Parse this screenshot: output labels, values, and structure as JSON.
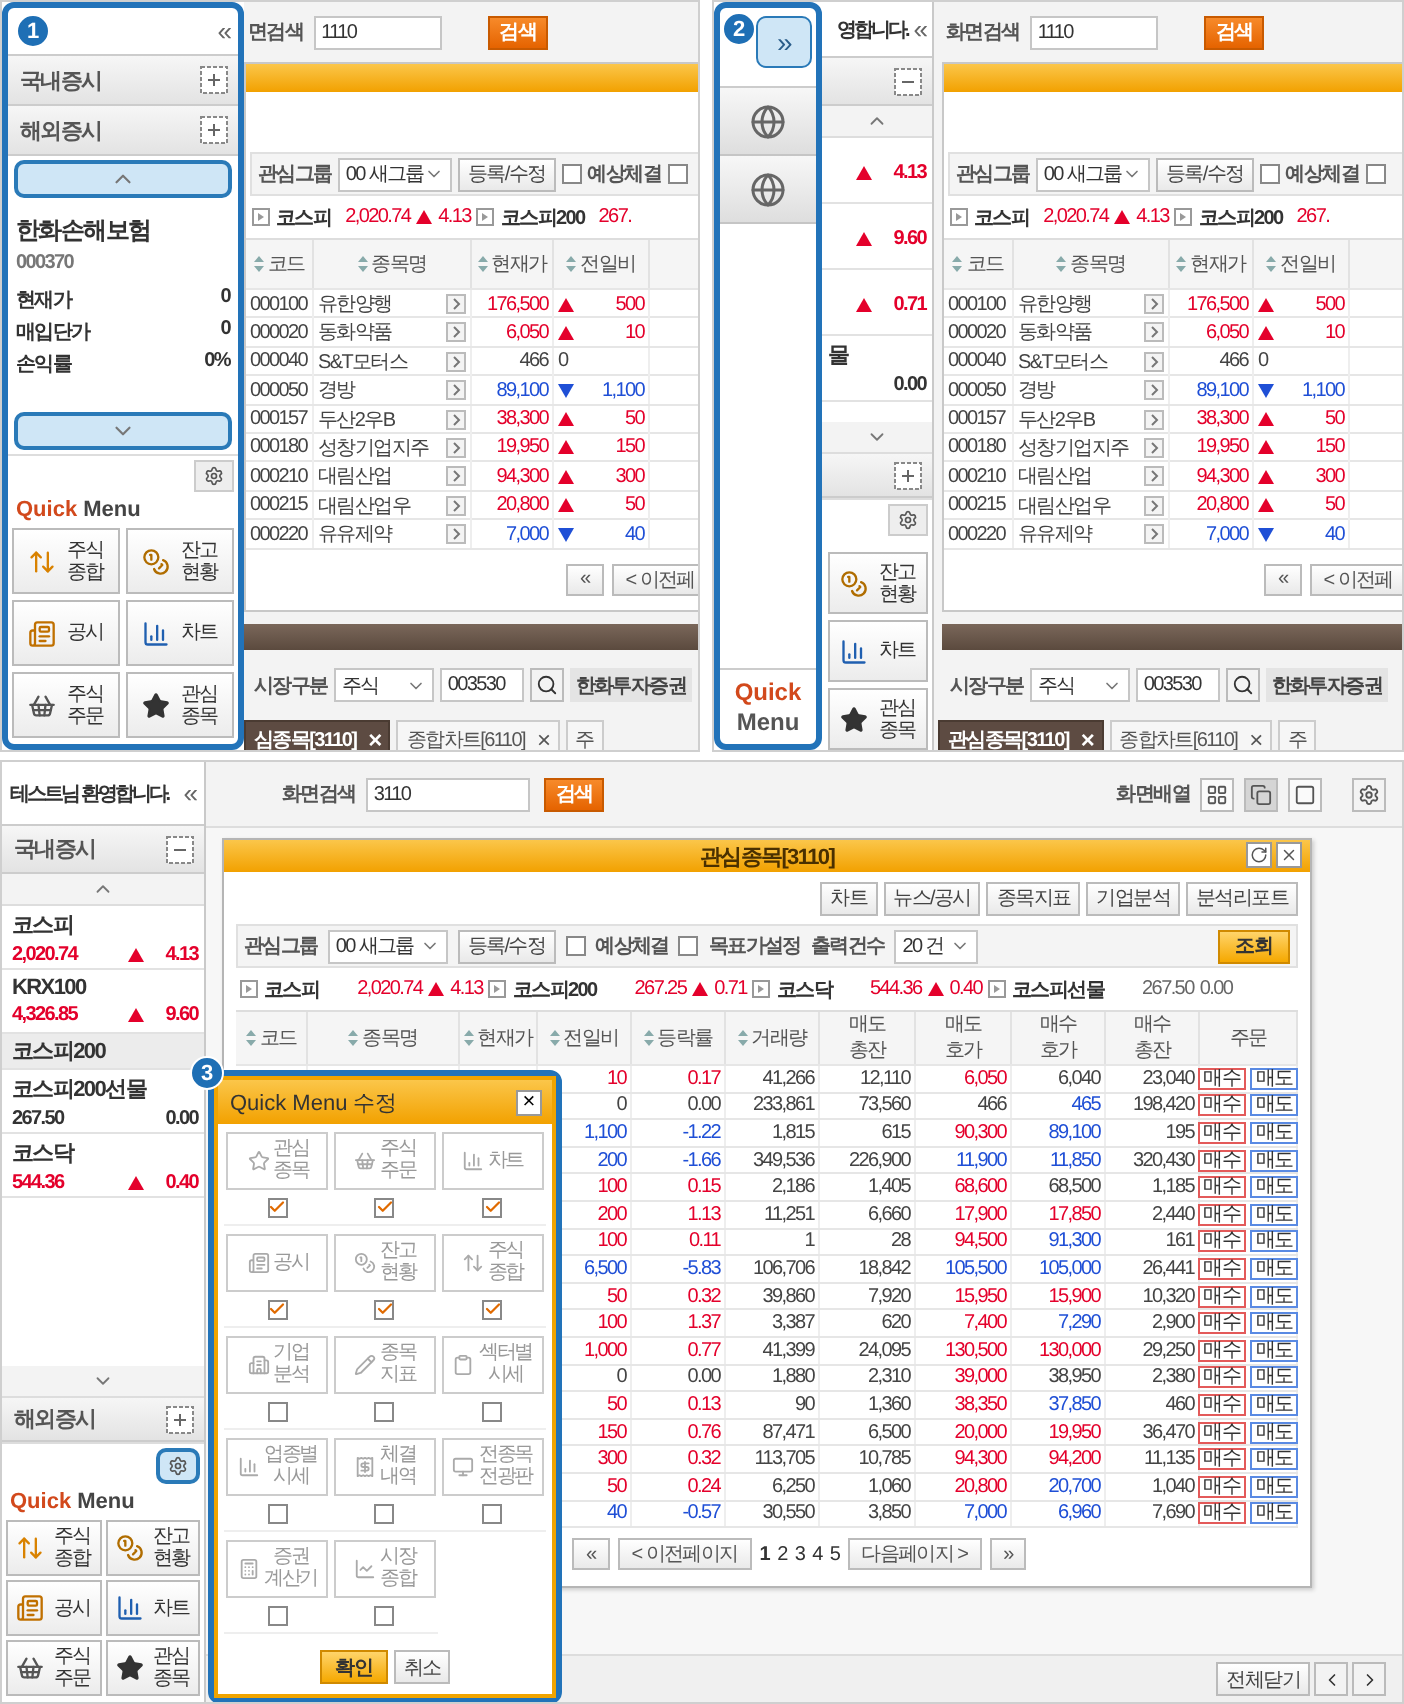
{
  "panel_1": {
    "badge": "1",
    "sidebar": {
      "collapse": "«",
      "sections": [
        {
          "label": "국내증시",
          "expanded": false
        },
        {
          "label": "해외증시",
          "expanded": false
        }
      ],
      "holding": {
        "name": "한화손해보험",
        "code": "000370",
        "fields": [
          {
            "label": "현재가",
            "value": "0"
          },
          {
            "label": "매입단가",
            "value": "0"
          },
          {
            "label": "손익률",
            "value": "0%"
          }
        ]
      },
      "settings_active": false,
      "quick_menu": {
        "accent": "Quick",
        "title": "Menu",
        "buttons": [
          {
            "kind": "updown",
            "lines": [
              "주식",
              "종합"
            ]
          },
          {
            "kind": "balance",
            "lines": [
              "잔고",
              "현황"
            ]
          },
          {
            "kind": "notice",
            "lines": [
              "공시"
            ]
          },
          {
            "kind": "chart",
            "lines": [
              "차트"
            ]
          },
          {
            "kind": "basket",
            "lines": [
              "주식",
              "주문"
            ]
          },
          {
            "kind": "star",
            "lines": [
              "관심",
              "종목"
            ]
          }
        ]
      }
    },
    "main": {
      "search": {
        "label": "면검색",
        "value": "1110",
        "button": "검색"
      },
      "group": {
        "label": "관심그룹",
        "value": "00 새그룹",
        "button": "등록/수정",
        "checks": [
          {
            "label": "예상체결",
            "checked": false
          },
          {
            "checked": false
          }
        ]
      },
      "indices": [
        {
          "name": "코스피",
          "value": "2,020.74",
          "change": "4.13",
          "rising": true,
          "falling": false
        },
        {
          "name": "코스피200",
          "value": "267.",
          "rising": true,
          "falling": false
        }
      ],
      "columns": [
        "코드",
        "종목명",
        "현재가",
        "전일비"
      ],
      "rows": [
        {
          "code": "000100",
          "name": "유한양행",
          "price": "176,500",
          "change": "500",
          "rising": true,
          "falling": false
        },
        {
          "code": "000020",
          "name": "동화약품",
          "price": "6,050",
          "change": "10",
          "rising": true,
          "falling": false
        },
        {
          "code": "000040",
          "name": "S&T모터스",
          "price": "466",
          "change": "0",
          "rising": false,
          "falling": false
        },
        {
          "code": "000050",
          "name": "경방",
          "price": "89,100",
          "change": "1,100",
          "rising": false,
          "falling": true
        },
        {
          "code": "000157",
          "name": "두산2우B",
          "price": "38,300",
          "change": "50",
          "rising": true,
          "falling": false
        },
        {
          "code": "000180",
          "name": "성창기업지주",
          "price": "19,950",
          "change": "150",
          "rising": true,
          "falling": false
        },
        {
          "code": "000210",
          "name": "대림산업",
          "price": "94,300",
          "change": "300",
          "rising": true,
          "falling": false
        },
        {
          "code": "000215",
          "name": "대림산업우",
          "price": "20,800",
          "change": "50",
          "rising": true,
          "falling": false
        },
        {
          "code": "000220",
          "name": "유유제약",
          "price": "7,000",
          "change": "40",
          "rising": false,
          "falling": true
        }
      ],
      "pager": [
        "«",
        "< 이전페"
      ],
      "market": {
        "label": "시장구분",
        "value": "주식",
        "code": "003530",
        "name": "한화투자증권"
      },
      "tabs": [
        {
          "label": "심종목[3110]",
          "close": "×",
          "selected": true
        },
        {
          "label": "종합차트[6110]",
          "close": "×",
          "selected": false
        },
        {
          "label": "주",
          "selected": false
        }
      ]
    }
  },
  "panel_2": {
    "badge": "2",
    "expand": "»",
    "strip_quick": {
      "accent": "Quick",
      "title": "Menu"
    },
    "behind": {
      "welcome": "영합니다.",
      "collapse": "«",
      "sections": [
        {
          "expanded": true
        },
        {
          "expanded": false
        }
      ],
      "quotes": [
        {
          "change": "4.13",
          "rising": true,
          "falling": false
        },
        {
          "change": "9.60",
          "rising": true,
          "falling": false
        },
        {
          "change": "0.71",
          "rising": true,
          "falling": false
        },
        {
          "name": "물",
          "change": "0.00",
          "rising": false,
          "falling": false
        }
      ],
      "buttons": [
        {
          "kind": "balance",
          "lines": [
            "잔고",
            "현황"
          ]
        },
        {
          "kind": "chart",
          "lines": [
            "차트"
          ]
        },
        {
          "kind": "star",
          "lines": [
            "관심",
            "종목"
          ]
        }
      ]
    },
    "main": {
      "search": {
        "label": "화면검색",
        "value": "1110",
        "button": "검색"
      },
      "group": {
        "label": "관심그룹",
        "value": "00 새그룹",
        "button": "등록/수정",
        "checks": [
          {
            "label": "예상체결",
            "checked": false
          },
          {
            "checked": false
          }
        ]
      },
      "indices": [
        {
          "name": "코스피",
          "value": "2,020.74",
          "change": "4.13",
          "rising": true,
          "falling": false
        },
        {
          "name": "코스피200",
          "value": "267.",
          "rising": true,
          "falling": false
        }
      ],
      "columns": [
        "코드",
        "종목명",
        "현재가",
        "전일비"
      ],
      "rows": [
        {
          "code": "000100",
          "name": "유한양행",
          "price": "176,500",
          "change": "500",
          "rising": true,
          "falling": false
        },
        {
          "code": "000020",
          "name": "동화약품",
          "price": "6,050",
          "change": "10",
          "rising": true,
          "falling": false
        },
        {
          "code": "000040",
          "name": "S&T모터스",
          "price": "466",
          "change": "0",
          "rising": false,
          "falling": false
        },
        {
          "code": "000050",
          "name": "경방",
          "price": "89,100",
          "change": "1,100",
          "rising": false,
          "falling": true
        },
        {
          "code": "000157",
          "name": "두산2우B",
          "price": "38,300",
          "change": "50",
          "rising": true,
          "falling": false
        },
        {
          "code": "000180",
          "name": "성창기업지주",
          "price": "19,950",
          "change": "150",
          "rising": true,
          "falling": false
        },
        {
          "code": "000210",
          "name": "대림산업",
          "price": "94,300",
          "change": "300",
          "rising": true,
          "falling": false
        },
        {
          "code": "000215",
          "name": "대림산업우",
          "price": "20,800",
          "change": "50",
          "rising": true,
          "falling": false
        },
        {
          "code": "000220",
          "name": "유유제약",
          "price": "7,000",
          "change": "40",
          "rising": false,
          "falling": true
        }
      ],
      "pager": [
        "«",
        "< 이전페"
      ],
      "market": {
        "label": "시장구분",
        "value": "주식",
        "code": "003530",
        "name": "한화투자증권"
      },
      "tabs": [
        {
          "label": "관심종목[3110]",
          "close": "×",
          "selected": true
        },
        {
          "label": "종합차트[6110]",
          "close": "×",
          "selected": false
        },
        {
          "label": "주",
          "selected": false
        }
      ]
    }
  },
  "panel_3": {
    "badge": "3",
    "sidebar": {
      "welcome": "테스트님 환영합니다.",
      "collapse": "«",
      "sections": [
        {
          "label": "국내증시",
          "expanded": true
        },
        {
          "label": "해외증시",
          "expanded": false
        }
      ],
      "quotes": [
        {
          "name": "코스피",
          "value": "2,020.74",
          "change": "4.13",
          "rising": true,
          "falling": false,
          "selected": false
        },
        {
          "name": "KRX100",
          "value": "4,326.85",
          "change": "9.60",
          "rising": true,
          "falling": false,
          "selected": false
        },
        {
          "name": "코스피200",
          "selected": true
        },
        {
          "name": "코스피200선물",
          "value": "267.50",
          "change": "0.00",
          "rising": false,
          "falling": false,
          "selected": false
        },
        {
          "name": "코스닥",
          "value": "544.36",
          "change": "0.40",
          "rising": true,
          "falling": false,
          "selected": false
        }
      ],
      "settings_active": true,
      "quick_menu": {
        "accent": "Quick",
        "title": "Menu",
        "buttons": [
          {
            "kind": "updown",
            "lines": [
              "주식",
              "종합"
            ]
          },
          {
            "kind": "balance",
            "lines": [
              "잔고",
              "현황"
            ]
          },
          {
            "kind": "notice",
            "lines": [
              "공시"
            ]
          },
          {
            "kind": "chart",
            "lines": [
              "차트"
            ]
          },
          {
            "kind": "basket",
            "lines": [
              "주식",
              "주문"
            ]
          },
          {
            "kind": "star",
            "lines": [
              "관심",
              "종목"
            ]
          }
        ]
      }
    },
    "topbar": {
      "search": {
        "label": "화면검색",
        "value": "3110",
        "button": "검색"
      },
      "layout_label": "화면배열",
      "layouts": [
        {
          "selected": false
        },
        {
          "selected": true
        },
        {
          "selected": false
        }
      ]
    },
    "window": {
      "title": "관심종목[3110]",
      "tools": [
        "차트",
        "뉴스/공시",
        "종목지표",
        "기업분석",
        "분석리포트"
      ],
      "group": {
        "label": "관심그룹",
        "value": "00 새그룹",
        "button": "등록/수정",
        "checks": [
          {
            "label": "예상체결",
            "checked": false
          },
          {
            "label": "목표가설정",
            "checked": false
          }
        ],
        "count_label": "출력건수",
        "count_value": "20 건",
        "query": "조회"
      },
      "indices": [
        {
          "name": "코스피",
          "value": "2,020.74",
          "change": "4.13",
          "rising": true,
          "falling": false
        },
        {
          "name": "코스피200",
          "value": "267.25",
          "change": "0.71",
          "rising": true,
          "falling": false
        },
        {
          "name": "코스닥",
          "value": "544.36",
          "change": "0.40",
          "rising": true,
          "falling": false
        },
        {
          "name": "코스피선물",
          "value": "267.50",
          "change": "0.00",
          "rising": false,
          "falling": false
        }
      ],
      "columns": [
        {
          "lines": [
            "코드"
          ],
          "sortable": true
        },
        {
          "lines": [
            "종목명"
          ],
          "sortable": true
        },
        {
          "lines": [
            "현재가"
          ],
          "sortable": true
        },
        {
          "lines": [
            "전일비"
          ],
          "sortable": true
        },
        {
          "lines": [
            "등락률"
          ],
          "sortable": true
        },
        {
          "lines": [
            "거래량"
          ],
          "sortable": true
        },
        {
          "lines": [
            "매도",
            "총잔"
          ],
          "sortable": false
        },
        {
          "lines": [
            "매도",
            "호가"
          ],
          "sortable": false
        },
        {
          "lines": [
            "매수",
            "호가"
          ],
          "sortable": false
        },
        {
          "lines": [
            "매수",
            "총잔"
          ],
          "sortable": false
        },
        {
          "lines": [
            "주문"
          ],
          "sortable": false
        }
      ],
      "rows": [
        {
          "change": "10",
          "rate": "0.17",
          "rising": true,
          "falling": false,
          "volume": "41,266",
          "ask_total": "12,110",
          "ask": "6,050",
          "ask_rising": true,
          "ask_falling": false,
          "bid": "6,040",
          "bid_rising": false,
          "bid_falling": false,
          "bid_total": "23,040",
          "buy": "매수",
          "sell": "매도"
        },
        {
          "change": "0",
          "rate": "0.00",
          "rising": false,
          "falling": false,
          "volume": "233,861",
          "ask_total": "73,560",
          "ask": "466",
          "ask_rising": false,
          "ask_falling": false,
          "bid": "465",
          "bid_rising": false,
          "bid_falling": true,
          "bid_total": "198,420",
          "buy": "매수",
          "sell": "매도"
        },
        {
          "change": "1,100",
          "rate": "-1.22",
          "rising": false,
          "falling": true,
          "volume": "1,815",
          "ask_total": "615",
          "ask": "90,300",
          "ask_rising": true,
          "ask_falling": false,
          "bid": "89,100",
          "bid_rising": false,
          "bid_falling": true,
          "bid_total": "195",
          "buy": "매수",
          "sell": "매도"
        },
        {
          "change": "200",
          "rate": "-1.66",
          "rising": false,
          "falling": true,
          "volume": "349,536",
          "ask_total": "226,900",
          "ask": "11,900",
          "ask_rising": false,
          "ask_falling": true,
          "bid": "11,850",
          "bid_rising": false,
          "bid_falling": true,
          "bid_total": "320,430",
          "buy": "매수",
          "sell": "매도"
        },
        {
          "change": "100",
          "rate": "0.15",
          "rising": true,
          "falling": false,
          "volume": "2,186",
          "ask_total": "1,405",
          "ask": "68,600",
          "ask_rising": true,
          "ask_falling": false,
          "bid": "68,500",
          "bid_rising": false,
          "bid_falling": false,
          "bid_total": "1,185",
          "buy": "매수",
          "sell": "매도"
        },
        {
          "change": "200",
          "rate": "1.13",
          "rising": true,
          "falling": false,
          "volume": "11,251",
          "ask_total": "6,660",
          "ask": "17,900",
          "ask_rising": true,
          "ask_falling": false,
          "bid": "17,850",
          "bid_rising": true,
          "bid_falling": false,
          "bid_total": "2,440",
          "buy": "매수",
          "sell": "매도"
        },
        {
          "change": "100",
          "rate": "0.11",
          "rising": true,
          "falling": false,
          "volume": "1",
          "ask_total": "28",
          "ask": "94,500",
          "ask_rising": true,
          "ask_falling": false,
          "bid": "91,300",
          "bid_rising": false,
          "bid_falling": true,
          "bid_total": "161",
          "buy": "매수",
          "sell": "매도"
        },
        {
          "change": "6,500",
          "rate": "-5.83",
          "rising": false,
          "falling": true,
          "volume": "106,706",
          "ask_total": "18,842",
          "ask": "105,500",
          "ask_rising": false,
          "ask_falling": true,
          "bid": "105,000",
          "bid_rising": false,
          "bid_falling": true,
          "bid_total": "26,441",
          "buy": "매수",
          "sell": "매도"
        },
        {
          "change": "50",
          "rate": "0.32",
          "rising": true,
          "falling": false,
          "volume": "39,860",
          "ask_total": "7,920",
          "ask": "15,950",
          "ask_rising": true,
          "ask_falling": false,
          "bid": "15,900",
          "bid_rising": true,
          "bid_falling": false,
          "bid_total": "10,320",
          "buy": "매수",
          "sell": "매도"
        },
        {
          "change": "100",
          "rate": "1.37",
          "rising": true,
          "falling": false,
          "volume": "3,387",
          "ask_total": "620",
          "ask": "7,400",
          "ask_rising": true,
          "ask_falling": false,
          "bid": "7,290",
          "bid_rising": false,
          "bid_falling": true,
          "bid_total": "2,900",
          "buy": "매수",
          "sell": "매도"
        },
        {
          "change": "1,000",
          "rate": "0.77",
          "rising": true,
          "falling": false,
          "volume": "41,399",
          "ask_total": "24,095",
          "ask": "130,500",
          "ask_rising": true,
          "ask_falling": false,
          "bid": "130,000",
          "bid_rising": true,
          "bid_falling": false,
          "bid_total": "29,250",
          "buy": "매수",
          "sell": "매도"
        },
        {
          "change": "0",
          "rate": "0.00",
          "rising": false,
          "falling": false,
          "volume": "1,880",
          "ask_total": "2,310",
          "ask": "39,000",
          "ask_rising": true,
          "ask_falling": false,
          "bid": "38,950",
          "bid_rising": false,
          "bid_falling": false,
          "bid_total": "2,380",
          "buy": "매수",
          "sell": "매도"
        },
        {
          "change": "50",
          "rate": "0.13",
          "rising": true,
          "falling": false,
          "volume": "90",
          "ask_total": "1,360",
          "ask": "38,350",
          "ask_rising": true,
          "ask_falling": false,
          "bid": "37,850",
          "bid_rising": false,
          "bid_falling": true,
          "bid_total": "460",
          "buy": "매수",
          "sell": "매도"
        },
        {
          "change": "150",
          "rate": "0.76",
          "rising": true,
          "falling": false,
          "volume": "87,471",
          "ask_total": "6,500",
          "ask": "20,000",
          "ask_rising": true,
          "ask_falling": false,
          "bid": "19,950",
          "bid_rising": true,
          "bid_falling": false,
          "bid_total": "36,470",
          "buy": "매수",
          "sell": "매도"
        },
        {
          "change": "300",
          "rate": "0.32",
          "rising": true,
          "falling": false,
          "volume": "113,705",
          "ask_total": "10,785",
          "ask": "94,300",
          "ask_rising": true,
          "ask_falling": false,
          "bid": "94,200",
          "bid_rising": true,
          "bid_falling": false,
          "bid_total": "11,135",
          "buy": "매수",
          "sell": "매도"
        },
        {
          "change": "50",
          "rate": "0.24",
          "rising": true,
          "falling": false,
          "volume": "6,250",
          "ask_total": "1,060",
          "ask": "20,800",
          "ask_rising": true,
          "ask_falling": false,
          "bid": "20,700",
          "bid_rising": false,
          "bid_falling": true,
          "bid_total": "1,040",
          "buy": "매수",
          "sell": "매도"
        },
        {
          "change": "40",
          "rate": "-0.57",
          "rising": false,
          "falling": true,
          "volume": "30,550",
          "ask_total": "3,850",
          "ask": "7,000",
          "ask_rising": false,
          "ask_falling": true,
          "bid": "6,960",
          "bid_rising": false,
          "bid_falling": true,
          "bid_total": "7,690",
          "buy": "매수",
          "sell": "매도"
        }
      ],
      "pager": {
        "first": "«",
        "prev": "< 이전페이지",
        "pages": [
          {
            "label": "1",
            "selected": true
          },
          {
            "label": "2",
            "selected": false
          },
          {
            "label": "3",
            "selected": false
          },
          {
            "label": "4",
            "selected": false
          },
          {
            "label": "5",
            "selected": false
          }
        ],
        "next": "다음페이지 >",
        "last": "»"
      }
    },
    "close_all": "전체닫기",
    "dialog": {
      "title": "Quick Menu 수정",
      "close": "×",
      "items": [
        {
          "kind": "star",
          "lines": [
            "관심",
            "종목"
          ],
          "checked": true
        },
        {
          "kind": "basket",
          "lines": [
            "주식",
            "주문"
          ],
          "checked": true
        },
        {
          "kind": "chart",
          "lines": [
            "차트"
          ],
          "checked": true
        },
        {
          "kind": "notice",
          "lines": [
            "공시"
          ],
          "checked": true
        },
        {
          "kind": "balance",
          "lines": [
            "잔고",
            "현황"
          ],
          "checked": true
        },
        {
          "kind": "updown",
          "lines": [
            "주식",
            "종합"
          ],
          "checked": true
        },
        {
          "kind": "corp",
          "lines": [
            "기업",
            "분석"
          ],
          "checked": false
        },
        {
          "kind": "indicator",
          "lines": [
            "종목",
            "지표"
          ],
          "checked": false
        },
        {
          "kind": "sector",
          "lines": [
            "섹터별",
            "시세"
          ],
          "checked": false
        },
        {
          "kind": "industry",
          "lines": [
            "업종별",
            "시세"
          ],
          "checked": false
        },
        {
          "kind": "fills",
          "lines": [
            "체결",
            "내역"
          ],
          "checked": false
        },
        {
          "kind": "board",
          "lines": [
            "전종목",
            "전광판"
          ],
          "checked": false
        },
        {
          "kind": "calculator",
          "lines": [
            "증권",
            "계산기"
          ],
          "checked": false
        },
        {
          "kind": "market",
          "lines": [
            "시장",
            "종합"
          ],
          "checked": false
        }
      ],
      "ok": "확인",
      "cancel": "취소"
    }
  }
}
